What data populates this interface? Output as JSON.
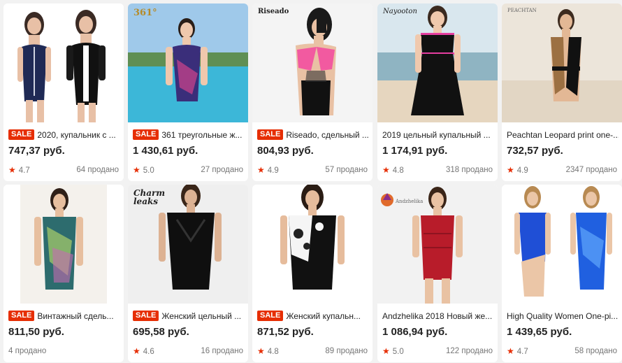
{
  "products": [
    {
      "sale": "SALE",
      "title": "2020, купальник с ...",
      "price": "747,37 руб.",
      "rating": "4.7",
      "sold": "64 продано"
    },
    {
      "sale": "SALE",
      "title": "361 треугольные ж...",
      "price": "1 430,61 руб.",
      "rating": "5.0",
      "sold": "27 продано",
      "brand": "361°"
    },
    {
      "sale": "SALE",
      "title": "Riseado, сдельный ...",
      "price": "804,93 руб.",
      "rating": "4.9",
      "sold": "57 продано",
      "brand": "Riseado"
    },
    {
      "sale": "",
      "title": "2019 цельный купальный ...",
      "price": "1 174,91 руб.",
      "rating": "4.8",
      "sold": "318 продано",
      "brand": "Nayooton"
    },
    {
      "sale": "",
      "title": "Peachtan Leopard print one-...",
      "price": "732,57 руб.",
      "rating": "4.9",
      "sold": "2347 продано",
      "brand": "PEACHTAN"
    },
    {
      "sale": "SALE",
      "title": "Винтажный сдель...",
      "price": "811,50 руб.",
      "rating": "",
      "sold": "4 продано"
    },
    {
      "sale": "SALE",
      "title": "Женский цельный ...",
      "price": "695,58 руб.",
      "rating": "4.6",
      "sold": "16 продано",
      "brand": "Charm leaks"
    },
    {
      "sale": "SALE",
      "title": "Женский купальн...",
      "price": "871,52 руб.",
      "rating": "4.8",
      "sold": "89 продано"
    },
    {
      "sale": "",
      "title": "Andzhelika 2018 Новый же...",
      "price": "1 086,94 руб.",
      "rating": "5.0",
      "sold": "122 продано",
      "brand": "Andzhelika"
    },
    {
      "sale": "",
      "title": "High Quality Women One-pi...",
      "price": "1 439,65 руб.",
      "rating": "4.7",
      "sold": "58 продано"
    }
  ],
  "icons": {
    "star": "star-icon"
  },
  "colors": {
    "accent": "#e62e04",
    "background": "#f2f2f2",
    "card": "#ffffff"
  }
}
